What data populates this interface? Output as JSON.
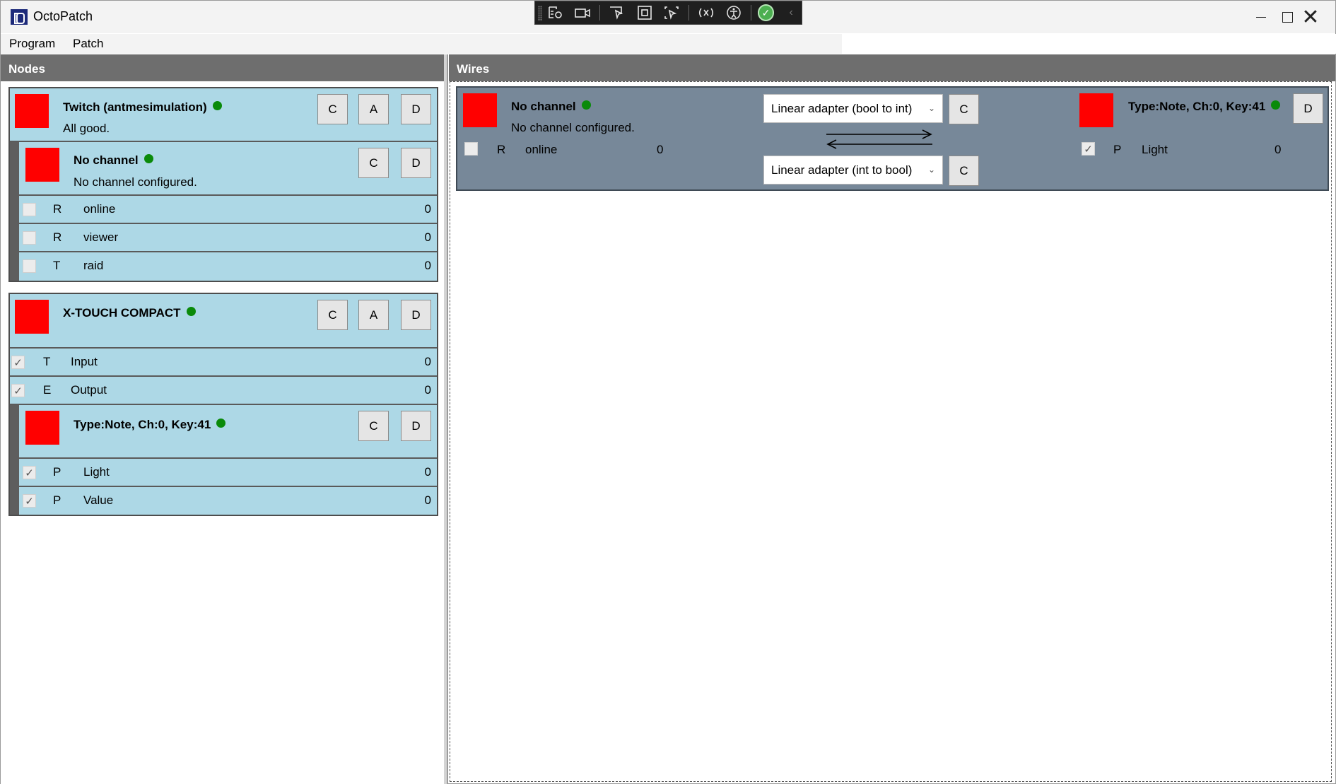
{
  "window": {
    "title": "OctoPatch",
    "minimize_icon": "minimize-icon",
    "maximize_icon": "maximize-icon",
    "close_glyph": "✕"
  },
  "menu": {
    "items": [
      "Program",
      "Patch"
    ]
  },
  "panels": {
    "nodes_title": "Nodes",
    "wires_title": "Wires"
  },
  "colors": {
    "card_bg": "#add8e6",
    "wire_bg": "#778899",
    "swatch": "#ff0000",
    "status_ok": "#0a8a0a",
    "header_bg": "#6e6e6e"
  },
  "nodes": [
    {
      "title": "Twitch (antmesimulation)",
      "status": "All good.",
      "buttons": [
        "C",
        "A",
        "D"
      ],
      "children": [
        {
          "title": "No channel",
          "status": "No channel configured.",
          "buttons": [
            "C",
            "D"
          ],
          "rows": [
            {
              "checked": false,
              "type": "R",
              "name": "online",
              "value": "0"
            },
            {
              "checked": false,
              "type": "R",
              "name": "viewer",
              "value": "0"
            },
            {
              "checked": false,
              "type": "T",
              "name": "raid",
              "value": "0"
            }
          ]
        }
      ]
    },
    {
      "title": "X-TOUCH COMPACT",
      "status": "",
      "buttons": [
        "C",
        "A",
        "D"
      ],
      "rows": [
        {
          "checked": true,
          "type": "T",
          "name": "Input",
          "value": "0"
        },
        {
          "checked": true,
          "type": "E",
          "name": "Output",
          "value": "0"
        }
      ],
      "children": [
        {
          "title": "Type:Note, Ch:0, Key:41",
          "status": "",
          "buttons": [
            "C",
            "D"
          ],
          "rows": [
            {
              "checked": true,
              "type": "P",
              "name": "Light",
              "value": "0"
            },
            {
              "checked": true,
              "type": "P",
              "name": "Value",
              "value": "0"
            }
          ]
        }
      ]
    }
  ],
  "wires": [
    {
      "source": {
        "title": "No channel",
        "status": "No channel configured.",
        "row": {
          "checked": false,
          "type": "R",
          "name": "online",
          "value": "0"
        }
      },
      "adapter_forward": "Linear adapter (bool to int)",
      "adapter_backward": "Linear adapter (int to bool)",
      "adapter_button": "C",
      "target": {
        "title": "Type:Note, Ch:0, Key:41",
        "button": "D",
        "row": {
          "checked": true,
          "type": "P",
          "name": "Light",
          "value": "0"
        }
      }
    }
  ]
}
